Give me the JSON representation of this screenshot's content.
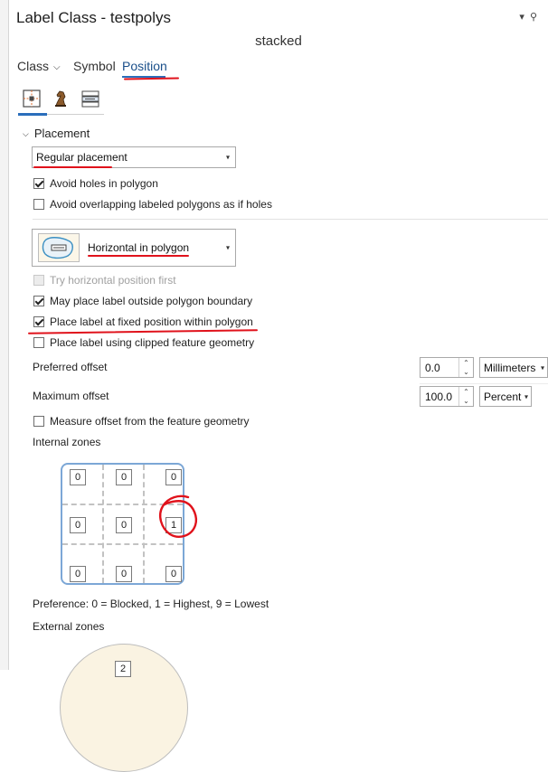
{
  "window": {
    "title": "Label Class - testpolys",
    "controls": [
      "▾",
      "⚲"
    ],
    "subtitle": "stacked"
  },
  "tabs": [
    {
      "label": "Class",
      "has_dropdown": true,
      "active": false
    },
    {
      "label": "Symbol",
      "active": false
    },
    {
      "label": "Position",
      "active": true
    }
  ],
  "icon_tabs": [
    "position-placement-icon",
    "chess-knight-icon",
    "label-stack-icon"
  ],
  "placement": {
    "section_title": "Placement",
    "placement_select": "Regular placement",
    "avoid_holes": {
      "label": "Avoid holes in polygon",
      "checked": true
    },
    "avoid_overlap": {
      "label": "Avoid overlapping labeled polygons as if holes",
      "checked": false
    },
    "polygon_placement_select": "Horizontal in polygon",
    "try_horizontal": {
      "label": "Try horizontal position first",
      "checked": false,
      "disabled": true
    },
    "may_place_outside": {
      "label": "May place label outside polygon boundary",
      "checked": true
    },
    "fixed_position": {
      "label": "Place label at fixed position within polygon",
      "checked": true
    },
    "clipped_geometry": {
      "label": "Place label using clipped feature geometry",
      "checked": false
    },
    "preferred_offset": {
      "label": "Preferred offset",
      "value": "0.0",
      "unit": "Millimeters"
    },
    "maximum_offset": {
      "label": "Maximum offset",
      "value": "100.0",
      "unit": "Percent"
    },
    "measure_offset": {
      "label": "Measure offset from the feature geometry",
      "checked": false
    },
    "internal_zones_label": "Internal zones",
    "internal_zones": [
      [
        "0",
        "0",
        "0"
      ],
      [
        "0",
        "0",
        "1"
      ],
      [
        "0",
        "0",
        "0"
      ]
    ],
    "preference_text": "Preference: 0 = Blocked, 1 = Highest, 9 = Lowest",
    "external_zones_label": "External zones",
    "external_zone_top": "2"
  },
  "colors": {
    "accent": "#2a6ebb",
    "annotation": "#e0121b"
  }
}
